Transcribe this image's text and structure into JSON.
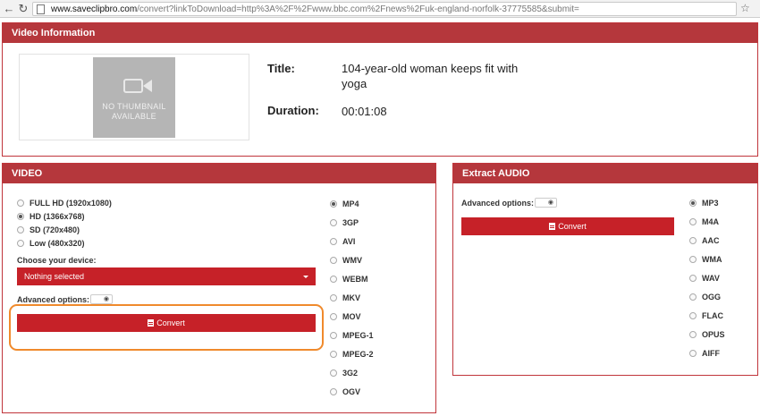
{
  "browser": {
    "url_host": "www.saveclipbro.com",
    "url_rest": "/convert?linkToDownload=http%3A%2F%2Fwww.bbc.com%2Fnews%2Fuk-england-norfolk-37775585&submit="
  },
  "video_info": {
    "header": "Video Information",
    "thumbnail_text_1": "NO THUMBNAIL",
    "thumbnail_text_2": "AVAILABLE",
    "title_label": "Title:",
    "title_line_1": "104-year-old woman keeps fit with",
    "title_line_2": "yoga",
    "duration_label": "Duration:",
    "duration_value": "00:01:08"
  },
  "video": {
    "header": "VIDEO",
    "qualities": [
      {
        "label": "FULL HD (1920x1080)",
        "checked": false
      },
      {
        "label": "HD (1366x768)",
        "checked": true
      },
      {
        "label": "SD (720x480)",
        "checked": false
      },
      {
        "label": "Low (480x320)",
        "checked": false
      }
    ],
    "device_label": "Choose your device:",
    "device_selected": "Nothing selected",
    "advanced_label": "Advanced options:",
    "convert_label": "Convert",
    "formats": [
      {
        "label": "MP4",
        "checked": true
      },
      {
        "label": "3GP",
        "checked": false
      },
      {
        "label": "AVI",
        "checked": false
      },
      {
        "label": "WMV",
        "checked": false
      },
      {
        "label": "WEBM",
        "checked": false
      },
      {
        "label": "MKV",
        "checked": false
      },
      {
        "label": "MOV",
        "checked": false
      },
      {
        "label": "MPEG-1",
        "checked": false
      },
      {
        "label": "MPEG-2",
        "checked": false
      },
      {
        "label": "3G2",
        "checked": false
      },
      {
        "label": "OGV",
        "checked": false
      }
    ]
  },
  "audio": {
    "header": "Extract AUDIO",
    "advanced_label": "Advanced options:",
    "convert_label": "Convert",
    "formats": [
      {
        "label": "MP3",
        "checked": true
      },
      {
        "label": "M4A",
        "checked": false
      },
      {
        "label": "AAC",
        "checked": false
      },
      {
        "label": "WMA",
        "checked": false
      },
      {
        "label": "WAV",
        "checked": false
      },
      {
        "label": "OGG",
        "checked": false
      },
      {
        "label": "FLAC",
        "checked": false
      },
      {
        "label": "OPUS",
        "checked": false
      },
      {
        "label": "AIFF",
        "checked": false
      }
    ]
  },
  "colors": {
    "header_red": "#b5373c",
    "button_red": "#c62128",
    "highlight_orange": "#f08a2c"
  },
  "icons": [
    "back-arrow-icon",
    "forward-arrow-icon",
    "reload-icon",
    "page-icon",
    "star-icon",
    "camera-icon",
    "eye-icon",
    "document-icon",
    "chevron-down-icon"
  ]
}
